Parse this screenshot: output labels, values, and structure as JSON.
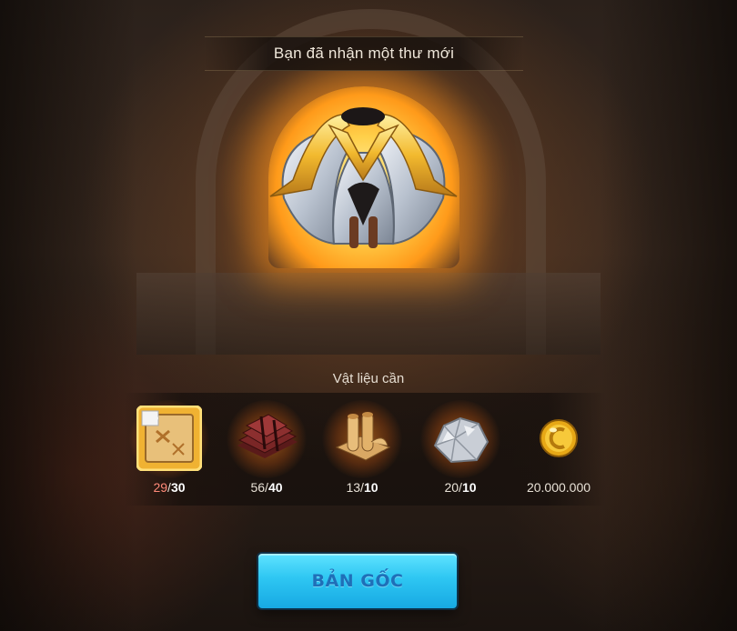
{
  "dialog": {
    "title": "Bạn đã nhận một thư mới"
  },
  "reward": {
    "icon": "golden-winged-helmet-icon"
  },
  "requirements": {
    "title": "Vật liệu cần",
    "items": [
      {
        "icon": "blueprint-scroll-icon",
        "have": "29",
        "sep": "/",
        "need": "30",
        "insufficient": true
      },
      {
        "icon": "leather-bundle-icon",
        "have": "56",
        "sep": "/",
        "need": "40",
        "insufficient": false
      },
      {
        "icon": "parchment-scrolls-icon",
        "have": "13",
        "sep": "/",
        "need": "10",
        "insufficient": false
      },
      {
        "icon": "silver-ore-icon",
        "have": "20",
        "sep": "/",
        "need": "10",
        "insufficient": false
      },
      {
        "icon": "gold-coin-icon",
        "amount": "20.000.000"
      }
    ]
  },
  "actions": {
    "primary_label": "BẢN GỐC"
  },
  "colors": {
    "button": "#2ec6f2",
    "button_text": "#1f6fb8",
    "insufficient": "#ff8a78",
    "forge_glow": "#ffb52a"
  }
}
